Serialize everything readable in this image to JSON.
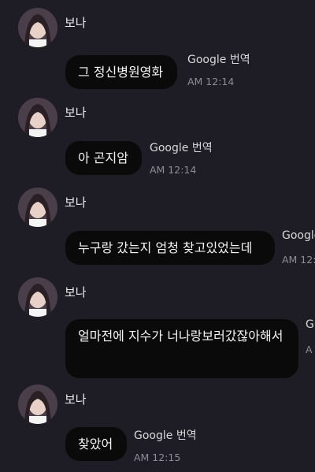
{
  "messages": [
    {
      "sender": "보나",
      "text": "그 정신병원영화",
      "translate_label": "Google 번역",
      "time": "AM 12:14"
    },
    {
      "sender": "보나",
      "text": "아 곤지암",
      "translate_label": "Google 번역",
      "time": "AM 12:14"
    },
    {
      "sender": "보나",
      "text": "누구랑 갔는지 엄청 찾고있었는데",
      "translate_label": "Google",
      "time": "AM 12:1"
    },
    {
      "sender": "보나",
      "text": "얼마전에 지수가 너나랑보러갔잖아해서",
      "translate_label": "G",
      "time": "A"
    },
    {
      "sender": "보나",
      "text": "찾았어",
      "translate_label": "Google 번역",
      "time": "AM 12:15"
    }
  ],
  "icons": {
    "avatar": "profile-photo-avatar"
  }
}
